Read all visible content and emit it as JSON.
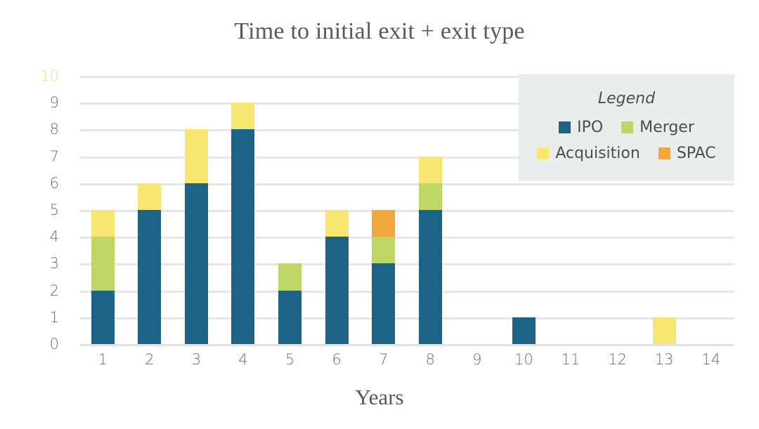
{
  "chart_data": {
    "type": "bar",
    "stacked": true,
    "title": "Time to initial exit + exit type",
    "xlabel": "Years",
    "ylabel": "",
    "categories": [
      "1",
      "2",
      "3",
      "4",
      "5",
      "6",
      "7",
      "8",
      "9",
      "10",
      "11",
      "12",
      "13",
      "14"
    ],
    "ylim": [
      0,
      10
    ],
    "yticks": [
      "0",
      "1",
      "2",
      "3",
      "4",
      "5",
      "6",
      "7",
      "8",
      "9",
      "10"
    ],
    "grid": true,
    "legend_position": "top-right",
    "legend_title": "Legend",
    "series": [
      {
        "name": "IPO",
        "color": "#1c6385",
        "values": [
          2,
          5,
          6,
          8,
          2,
          4,
          3,
          5,
          0,
          1,
          0,
          0,
          0,
          0
        ]
      },
      {
        "name": "Merger",
        "color": "#bcd764",
        "values": [
          2,
          0,
          0,
          0,
          1,
          0,
          1,
          1,
          0,
          0,
          0,
          0,
          0,
          0
        ]
      },
      {
        "name": "Acquisition",
        "color": "#f7e672",
        "values": [
          1,
          1,
          2,
          1,
          0,
          1,
          0,
          1,
          0,
          0,
          0,
          0,
          1,
          0
        ]
      },
      {
        "name": "SPAC",
        "color": "#f2a83c",
        "values": [
          0,
          0,
          0,
          0,
          0,
          0,
          1,
          0,
          0,
          0,
          0,
          0,
          0,
          0
        ]
      }
    ],
    "totals": [
      5,
      6,
      8,
      9,
      3,
      5,
      5,
      7,
      0,
      1,
      0,
      0,
      1,
      0
    ]
  },
  "axis": {
    "y_tick_top_color": "#d9e38d",
    "y_tick_color": "#6e6e6e",
    "gridline_color": "#e6e6e6"
  },
  "legend": {
    "title": "Legend",
    "rows": [
      [
        {
          "label": "IPO",
          "color": "#1c6385"
        },
        {
          "label": "Merger",
          "color": "#bcd764"
        }
      ],
      [
        {
          "label": "Acquisition",
          "color": "#f7e672"
        },
        {
          "label": "SPAC",
          "color": "#f2a83c"
        }
      ]
    ]
  }
}
